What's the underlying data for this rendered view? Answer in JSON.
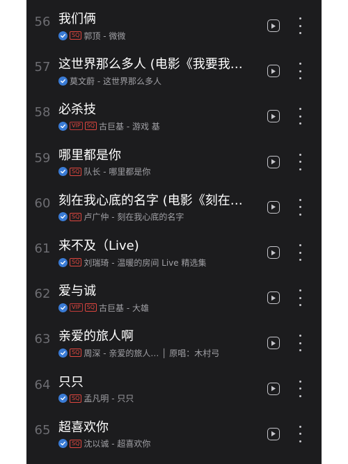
{
  "songs": [
    {
      "num": "56",
      "title": "我们俩",
      "badges": [
        "SQ"
      ],
      "meta": "郭顶 - 微微"
    },
    {
      "num": "57",
      "title": "这世界那么多人 (电影《我要我…",
      "badges": [],
      "meta": "莫文蔚 - 这世界那么多人"
    },
    {
      "num": "58",
      "title": "必杀技",
      "badges": [
        "VIP",
        "SQ"
      ],
      "meta": "古巨基 - 游戏 基"
    },
    {
      "num": "59",
      "title": "哪里都是你",
      "badges": [
        "SQ"
      ],
      "meta": "队长 - 哪里都是你"
    },
    {
      "num": "60",
      "title": "刻在我心底的名字 (电影《刻在…",
      "badges": [
        "SQ"
      ],
      "meta": "卢广仲 - 刻在我心底的名字"
    },
    {
      "num": "61",
      "title": "来不及（Live)",
      "badges": [
        "SQ"
      ],
      "meta": "刘瑞琦 - 温暖的房间 Live 精选集"
    },
    {
      "num": "62",
      "title": "爱与诚",
      "badges": [
        "VIP",
        "SQ"
      ],
      "meta": "古巨基 - 大雄"
    },
    {
      "num": "63",
      "title": "亲爱的旅人啊",
      "badges": [
        "SQ"
      ],
      "meta": "周深 - 亲爱的旅人… │ 原唱：木村弓"
    },
    {
      "num": "64",
      "title": "只只",
      "badges": [
        "SQ"
      ],
      "meta": "孟凡明 - 只只"
    },
    {
      "num": "65",
      "title": "超喜欢你",
      "badges": [
        "SQ"
      ],
      "meta": "沈以诚 - 超喜欢你"
    }
  ],
  "icons": {
    "verified": "check-circle-icon",
    "play": "play-button-icon",
    "more": "more-vertical-icon"
  },
  "colors": {
    "background": "#1c1c1e",
    "badge": "#e0473f",
    "verified": "#3a7bd5"
  }
}
